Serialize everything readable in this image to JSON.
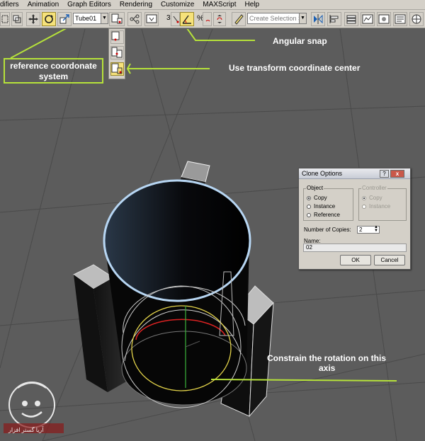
{
  "menubar": {
    "items": [
      "difiers",
      "Animation",
      "Graph Editors",
      "Rendering",
      "Customize",
      "MAXScript",
      "Help"
    ]
  },
  "toolbar": {
    "reference_coordinate_value": "Tube01",
    "selection_set_placeholder": "Create Selection Se",
    "snap_number": "3",
    "percent_snap_symbol": "%",
    "icons": [
      "select-region-icon",
      "move-icon",
      "rotate-icon",
      "scale-icon",
      "pivot-center-icon",
      "mirror-icon",
      "align-icon",
      "angle-snap-icon",
      "percent-snap-icon",
      "spinner-snap-icon",
      "edit-named-selection-icon",
      "layer-manager-icon",
      "schematic-view-icon",
      "material-editor-icon",
      "render-setup-icon",
      "render-icon"
    ]
  },
  "annotations": {
    "angular_snap": "Angular snap",
    "reference_coord_line1": "reference coordonate",
    "reference_coord_line2": "system",
    "transform_center": "Use transform coordinate center",
    "constrain_line1": "Constrain the rotation on this",
    "constrain_line2": "axis",
    "accent_color": "#b6e23a"
  },
  "dialog": {
    "title": "Clone Options",
    "help": "?",
    "close": "x",
    "object_group": "Object",
    "object_options": [
      "Copy",
      "Instance",
      "Reference"
    ],
    "object_selected": "Copy",
    "controller_group": "Controller",
    "controller_options": [
      "Copy",
      "Instance"
    ],
    "copies_label": "Number of Copies:",
    "copies_value": "2",
    "name_label": "Name:",
    "name_value": "02",
    "ok": "OK",
    "cancel": "Cancel"
  },
  "logo": {
    "text": "آریا گستر افزار"
  }
}
